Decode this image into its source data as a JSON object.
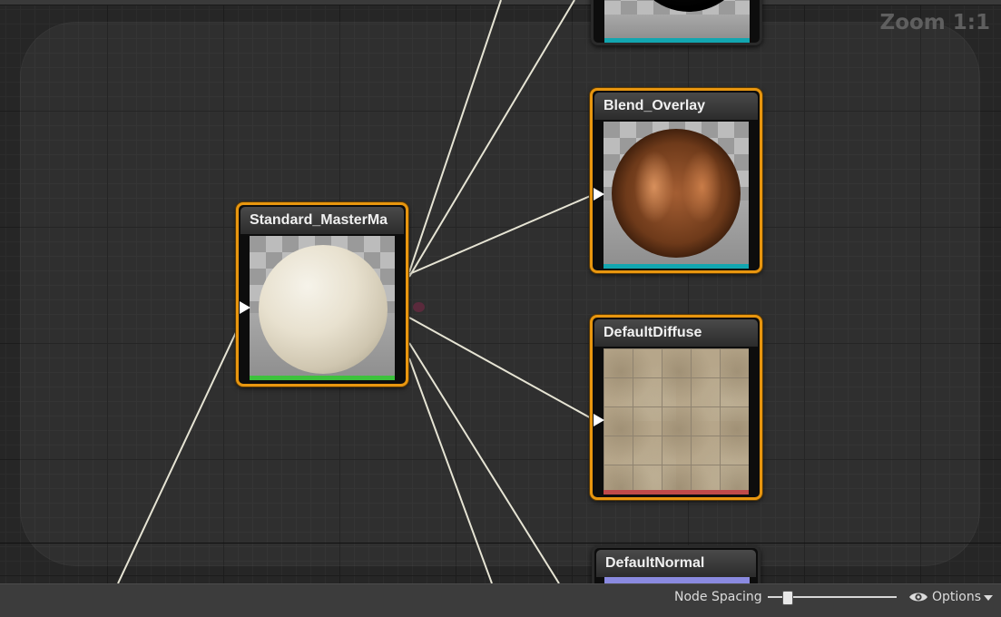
{
  "zoom_label": "Zoom 1:1",
  "nodes": {
    "top": {
      "title": "",
      "strip_color": "#12a6b0"
    },
    "master": {
      "title": "Standard_MasterMa",
      "strip_color": "#3cc23c"
    },
    "blend": {
      "title": "Blend_Overlay",
      "strip_color": "#12a6b0"
    },
    "diffuse": {
      "title": "DefaultDiffuse",
      "strip_color": "#c04a4a"
    },
    "normal": {
      "title": "DefaultNormal",
      "strip_color": "#8a8ae0"
    }
  },
  "bottom_bar": {
    "node_spacing_label": "Node Spacing",
    "node_spacing_value": 0.15,
    "options_label": "Options"
  },
  "colors": {
    "selected_border": "#e8960f",
    "wire": "#e6e4d4",
    "canvas": "#262626"
  }
}
